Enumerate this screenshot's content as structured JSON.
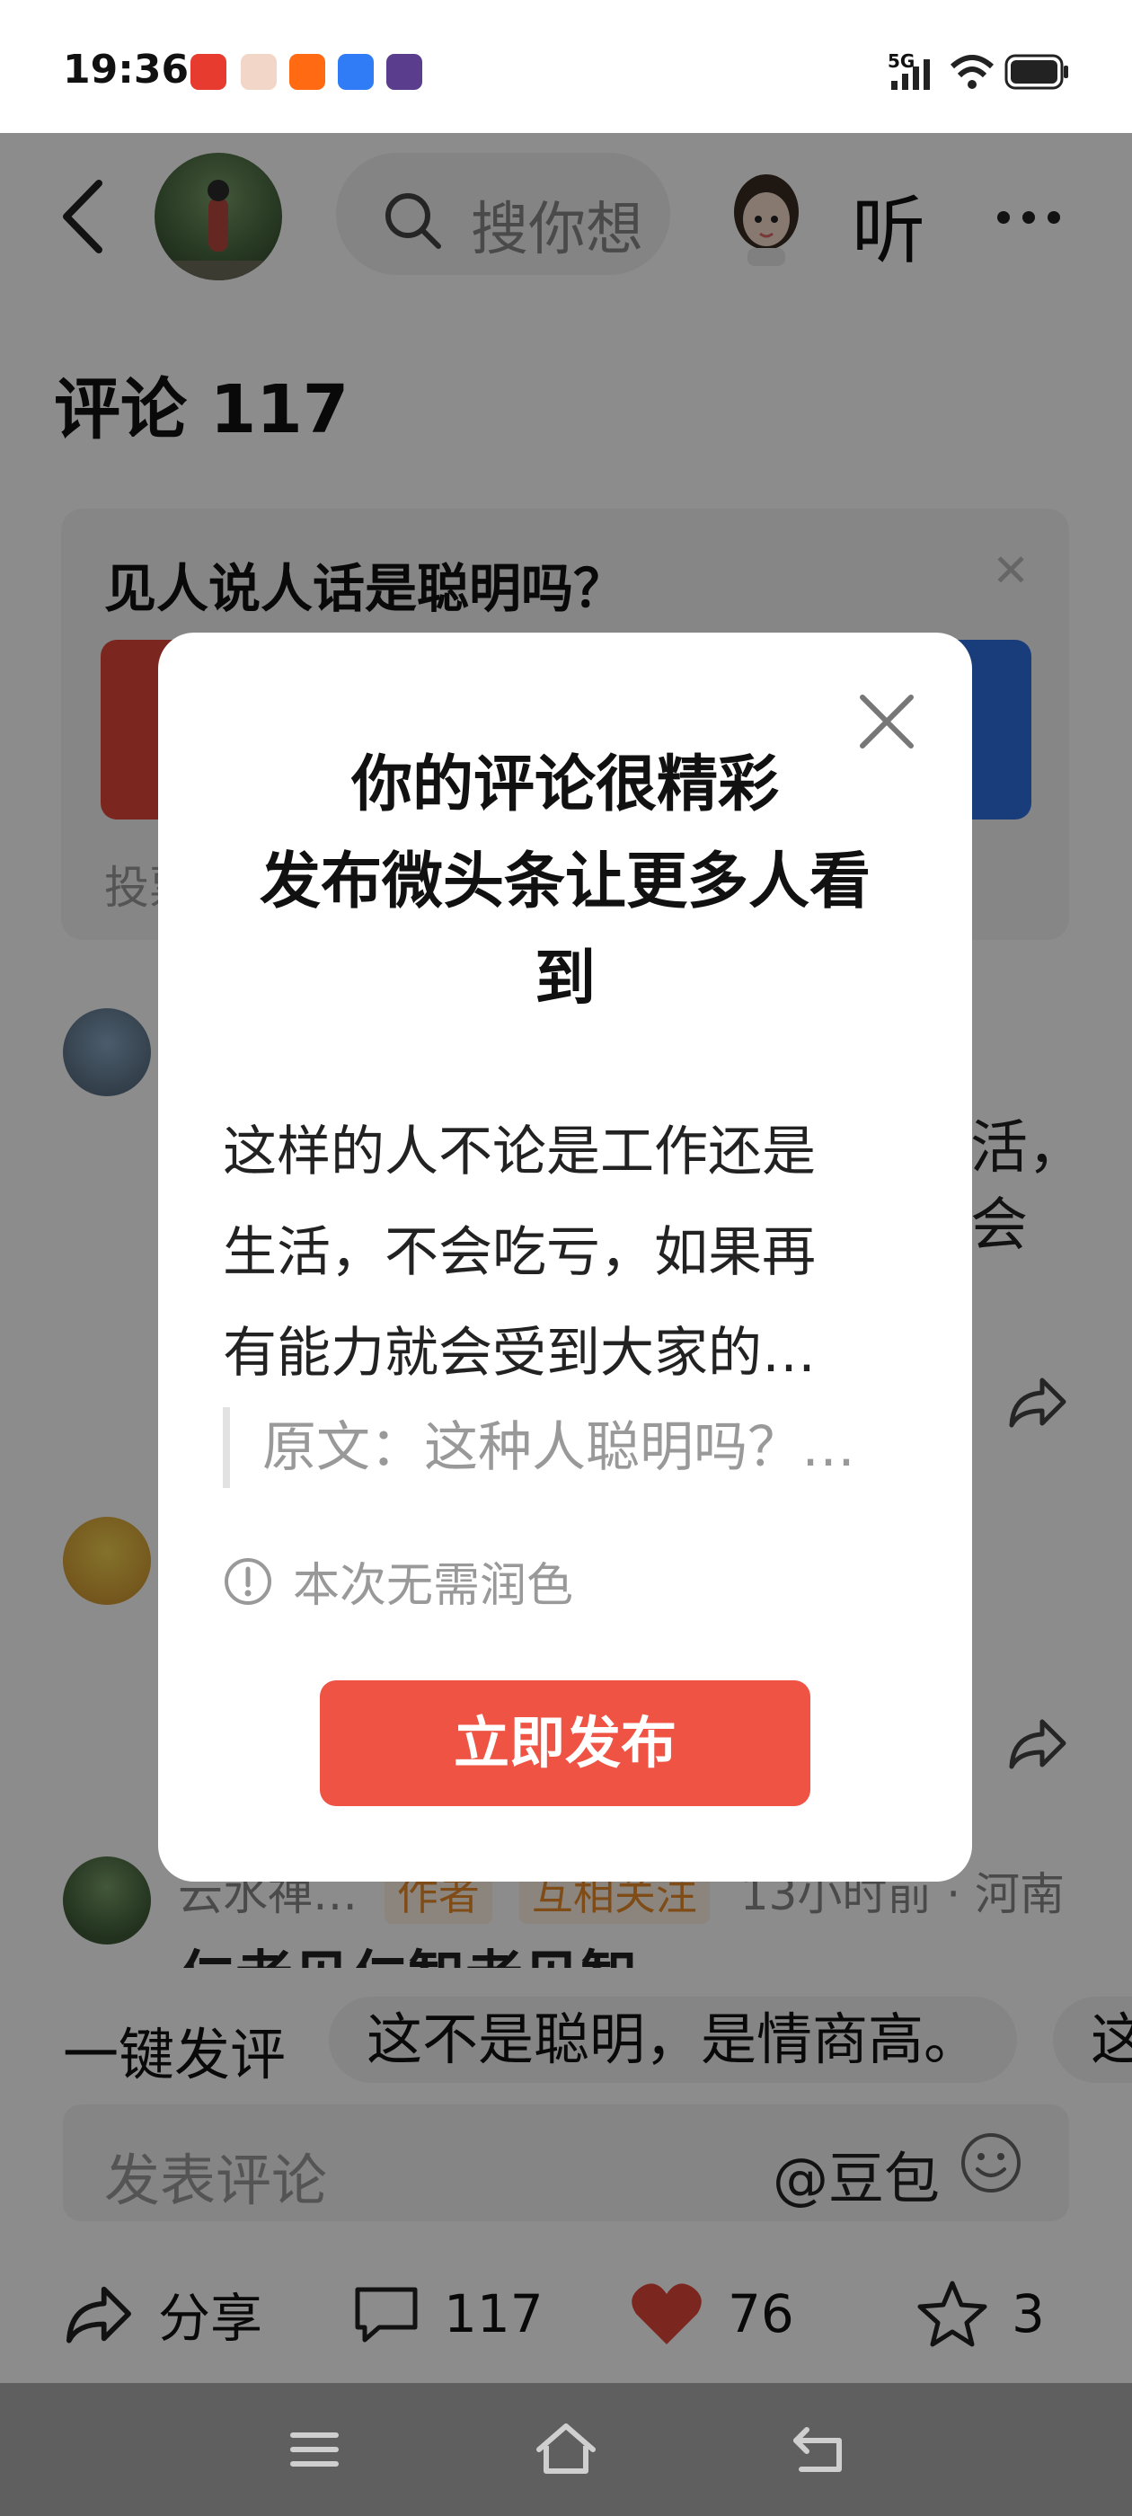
{
  "status_bar": {
    "time": "19:36",
    "network": "5G",
    "icons": [
      "toutiao-app-icon",
      "avatar-app-icon",
      "kuaishou-app-icon",
      "baidu-app-icon",
      "game-app-icon",
      "signal-icon",
      "wifi-icon",
      "battery-icon"
    ]
  },
  "header": {
    "search_placeholder": "搜你想",
    "listen_label": "听"
  },
  "comments": {
    "title": "评论 117",
    "fragment_1a": "活，",
    "fragment_1b": "会",
    "third_meta_name": "云水禅…",
    "third_meta_tag_author": "作者",
    "third_meta_tag_mutual": "互相关注",
    "third_meta_time": "13小时前 · 河南",
    "third_text_partial": "仁者见仁智者见智"
  },
  "poll": {
    "question": "见人说人话是聪明吗？",
    "footer_partial": "投票"
  },
  "quick_reply": {
    "label": "一键发评",
    "chips": [
      "这不是聪明，是情商高。",
      "这"
    ]
  },
  "comment_input": {
    "placeholder": "发表评论",
    "doubao": "@豆包"
  },
  "actions": {
    "share_label": "分享",
    "comment_count": "117",
    "like_count": "76",
    "favorite_count": "3",
    "like_color": "#e0473b"
  },
  "dialog": {
    "title_line1": "你的评论很精彩",
    "title_line2": "发布微头条让更多人看",
    "title_line3": "到",
    "body_line1": "这样的人不论是工作还是",
    "body_line2": "生活，不会吃亏，如果再",
    "body_line3": "有能力就会受到大家的…",
    "original_text": "原文：这种人聪明吗？…",
    "note": "本次无需润色",
    "publish_button": "立即发布",
    "button_color": "#ef5344"
  }
}
